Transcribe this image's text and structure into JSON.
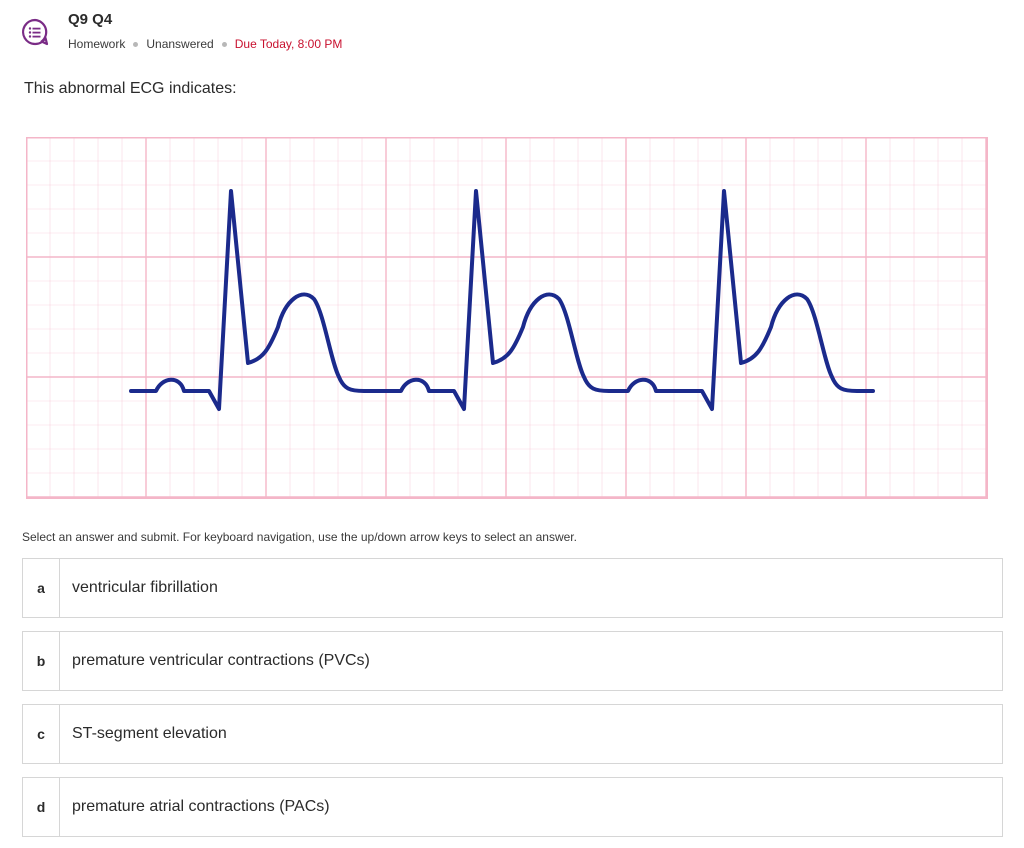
{
  "header": {
    "title": "Q9 Q4",
    "type": "Homework",
    "status": "Unanswered",
    "due": "Due Today, 8:00 PM",
    "icon": "question-list-icon"
  },
  "question": {
    "prompt": "This abnormal ECG indicates:",
    "figure": {
      "kind": "ECG strip",
      "grid_color": "#f4b6c8",
      "trace_color": "#1b2a8c",
      "complexes": 3
    }
  },
  "instructions": "Select an answer and submit. For keyboard navigation, use the up/down arrow keys to select an answer.",
  "options": [
    {
      "letter": "a",
      "text": "ventricular fibrillation"
    },
    {
      "letter": "b",
      "text": "premature ventricular contractions (PVCs)"
    },
    {
      "letter": "c",
      "text": "ST-segment elevation"
    },
    {
      "letter": "d",
      "text": "premature atrial contractions (PACs)"
    }
  ],
  "colors": {
    "accent": "#7a2c86",
    "due": "#c8102e",
    "border": "#d6d6d6"
  }
}
